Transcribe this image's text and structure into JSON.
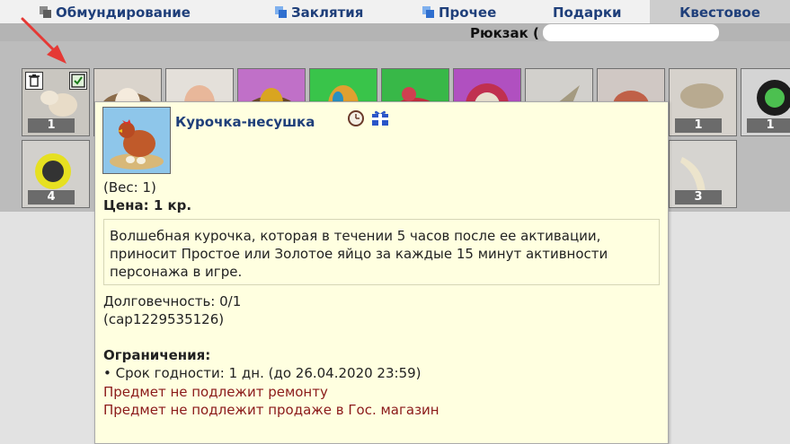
{
  "tabs": [
    {
      "label": "Обмундирование",
      "icon": "grey-squares-icon"
    },
    {
      "label": "Заклятия",
      "icon": "blue-squares-icon"
    },
    {
      "label": "Прочее",
      "icon": "blue-squares-icon"
    },
    {
      "label": "Подарки"
    },
    {
      "label": "Квестовое",
      "active": true
    }
  ],
  "bag": {
    "title": "Рюкзак ("
  },
  "inventory": {
    "row1_counts": [
      "1",
      "1",
      "1"
    ],
    "row2_counts": [
      "4",
      "3"
    ]
  },
  "tooltip": {
    "name": "Курочка-несушка",
    "weight": "(Вес: 1)",
    "price_label": "Цена:",
    "price_value": "1 кр.",
    "description": [
      "Волшебная курочка, которая в течении 5 часов после ее активации,",
      "приносит Простое или Золотое яйцо за каждые 15 минут активности",
      "персонажа в игре."
    ],
    "durability": "Долговечность: 0/1",
    "item_code": "(cap1229535126)",
    "restrictions_title": "Ограничения:",
    "expiry": "• Срок годности: 1 дн. (до 26.04.2020 23:59)",
    "warnings": [
      "Предмет не подлежит ремонту",
      "Предмет не подлежит продаже в Гос. магазин"
    ]
  },
  "colors": {
    "tab_text": "#1f3f7a",
    "tooltip_bg": "#ffffe0",
    "warning_text": "#8b1a1a",
    "arrow": "#e53935"
  }
}
